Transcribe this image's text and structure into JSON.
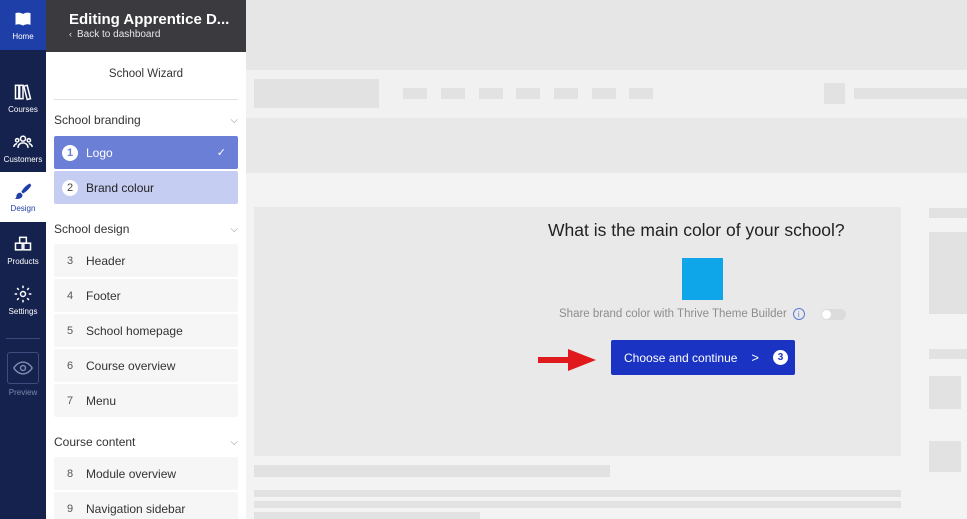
{
  "rail": {
    "home": "Home",
    "courses": "Courses",
    "customers": "Customers",
    "design": "Design",
    "products": "Products",
    "settings": "Settings",
    "preview": "Preview"
  },
  "panel": {
    "title": "Editing Apprentice D...",
    "back_label": "Back to dashboard",
    "wizard_title": "School Wizard"
  },
  "sections": [
    {
      "label": "School branding",
      "steps": [
        {
          "num": "1",
          "label": "Logo",
          "check": "✓"
        },
        {
          "num": "2",
          "label": "Brand colour"
        }
      ]
    },
    {
      "label": "School design",
      "steps": [
        {
          "num": "3",
          "label": "Header"
        },
        {
          "num": "4",
          "label": "Footer"
        },
        {
          "num": "5",
          "label": "School homepage"
        },
        {
          "num": "6",
          "label": "Course overview"
        },
        {
          "num": "7",
          "label": "Menu"
        }
      ]
    },
    {
      "label": "Course content",
      "steps": [
        {
          "num": "8",
          "label": "Module overview"
        },
        {
          "num": "9",
          "label": "Navigation sidebar"
        }
      ]
    }
  ],
  "main": {
    "question": "What is the main color of your school?",
    "swatch_color": "#0ea5e9",
    "share_label": "Share brand color with Thrive Theme Builder",
    "info_icon": "i",
    "cta_label": "Choose and continue",
    "cta_chevron": ">",
    "cta_badge": "3"
  },
  "colors": {
    "rail_bg": "#15224d",
    "accent": "#1b33c3",
    "step_done": "#6b7fd7",
    "step_current": "#c5cdf2",
    "arrow": "#e0191d"
  }
}
